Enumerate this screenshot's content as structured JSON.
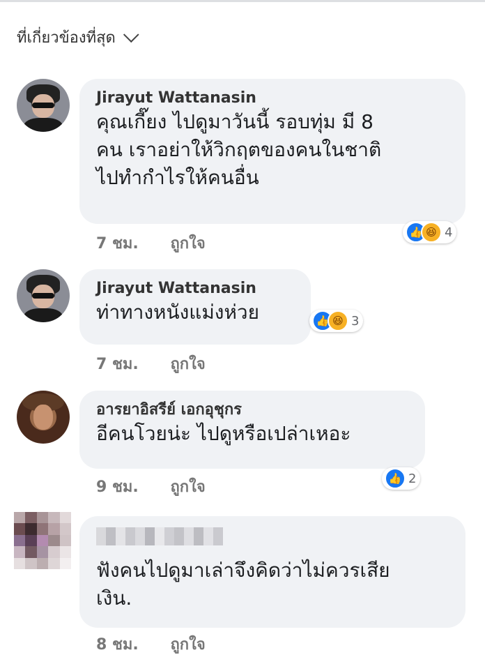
{
  "sort_label": "ที่เกี่ยวข้องที่สุด",
  "comments": [
    {
      "name": "Jirayut Wattanasin",
      "lines": [
        "คุณเกี๊ยง ไปดูมาวันนี้ รอบทุ่ม  มี 8",
        "คน เราอย่าให้วิกฤตของคนในชาติ",
        "ไปทำกำไรให้คนอื่น"
      ],
      "time": "7 ชม.",
      "like_label": "ถูกใจ",
      "reactions": [
        "like-icon",
        "haha-icon"
      ],
      "reaction_count": "4"
    },
    {
      "name": "Jirayut Wattanasin",
      "lines": [
        "ท่าทางหนังแม่งห่วย"
      ],
      "time": "7 ชม.",
      "like_label": "ถูกใจ",
      "reactions": [
        "like-icon",
        "haha-icon"
      ],
      "reaction_count": "3"
    },
    {
      "name": "อารยาอิสรีย์ เอกอุชุกร",
      "lines": [
        "อีคนโวยน่ะ  ไปดูหรือเปล่าเหอะ"
      ],
      "time": "9 ชม.",
      "like_label": "ถูกใจ",
      "reactions": [
        "like-icon"
      ],
      "reaction_count": "2"
    },
    {
      "name": "",
      "lines": [
        "ฟังคนไปดูมาเล่าจึงคิดว่าไม่ควรเสีย",
        "เงิน."
      ],
      "time": "8 ชม.",
      "like_label": "ถูกใจ"
    }
  ],
  "colors": {
    "bubble": "#f0f2f5",
    "like": "#1877f2",
    "haha": "#f7b125"
  }
}
